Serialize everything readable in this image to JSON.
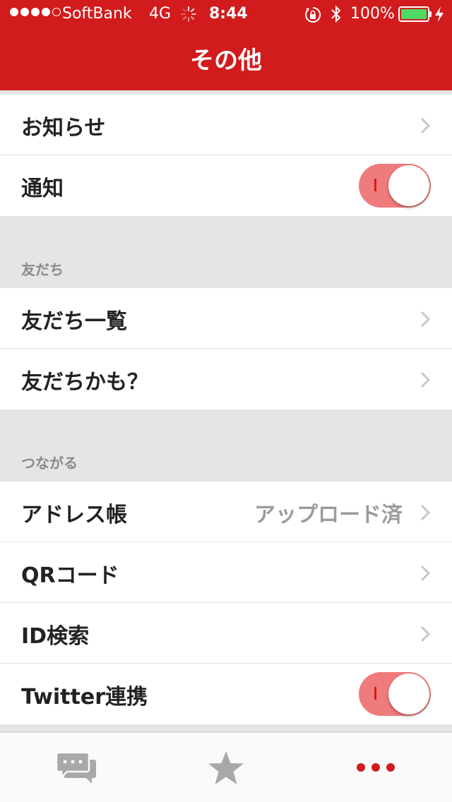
{
  "status_bar": {
    "carrier": "SoftBank",
    "network": "4G",
    "time": "8:44",
    "battery": "100%",
    "signal_bars_filled": 4,
    "signal_bars_total": 5
  },
  "nav": {
    "title": "その他"
  },
  "rows": {
    "news": {
      "label": "お知らせ"
    },
    "notifications": {
      "label": "通知",
      "toggle_on": true
    },
    "friends_list": {
      "label": "友だち一覧"
    },
    "maybe_friends": {
      "label": "友だちかも？"
    },
    "address_book": {
      "label": "アドレス帳",
      "detail": "アップロード済"
    },
    "qr_code": {
      "label": "QRコード"
    },
    "id_search": {
      "label": "ID検索"
    },
    "twitter": {
      "label": "Twitter連携",
      "toggle_on": true
    }
  },
  "sections": {
    "friends": "友だち",
    "connect": "つながる"
  },
  "tab_bar": {
    "tabs": [
      {
        "icon": "chat-bubbles-icon",
        "active": false
      },
      {
        "icon": "star-icon",
        "active": false
      },
      {
        "icon": "more-dots-icon",
        "active": true
      }
    ]
  },
  "colors": {
    "brand_red": "#d21b1c",
    "toggle_track": "#f07b7d",
    "section_bg": "#e6e5e6",
    "inactive_icon": "#a8a8a8"
  }
}
